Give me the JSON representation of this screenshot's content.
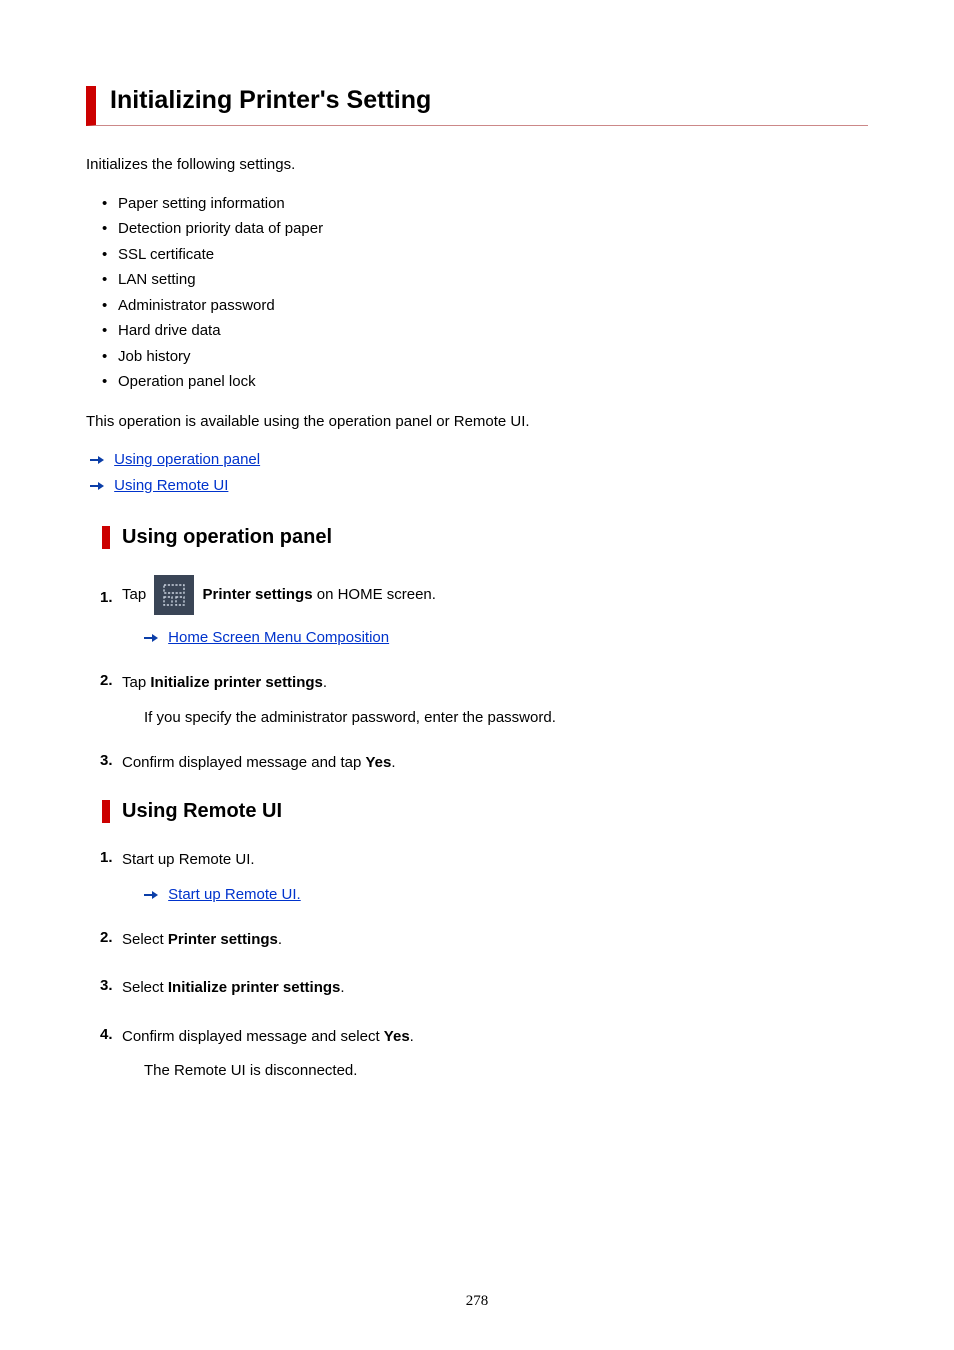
{
  "title": "Initializing Printer's Setting",
  "intro": "Initializes the following settings.",
  "settings_list": [
    "Paper setting information",
    "Detection priority data of paper",
    "SSL certificate",
    "LAN setting",
    "Administrator password",
    "Hard drive data",
    "Job history",
    "Operation panel lock"
  ],
  "availability": "This operation is available using the operation panel or Remote UI.",
  "method_links": {
    "operation_panel": "Using operation panel",
    "remote_ui": "Using Remote UI"
  },
  "section_op": {
    "heading": "Using operation panel",
    "step1": {
      "prefix": "Tap ",
      "bold": "Printer settings",
      "suffix": " on HOME screen.",
      "sublink": "Home Screen Menu Composition"
    },
    "step2": {
      "prefix": "Tap ",
      "bold": "Initialize printer settings",
      "suffix": ".",
      "note": "If you specify the administrator password, enter the password."
    },
    "step3": {
      "prefix": "Confirm displayed message and tap ",
      "bold": "Yes",
      "suffix": "."
    }
  },
  "section_rui": {
    "heading": "Using Remote UI",
    "step1": {
      "text": "Start up Remote UI.",
      "sublink": "Start up Remote UI."
    },
    "step2": {
      "prefix": "Select ",
      "bold": "Printer settings",
      "suffix": "."
    },
    "step3": {
      "prefix": "Select ",
      "bold": "Initialize printer settings",
      "suffix": "."
    },
    "step4": {
      "prefix": "Confirm displayed message and select ",
      "bold": "Yes",
      "suffix": ".",
      "note": "The Remote UI is disconnected."
    }
  },
  "page_number": "278"
}
